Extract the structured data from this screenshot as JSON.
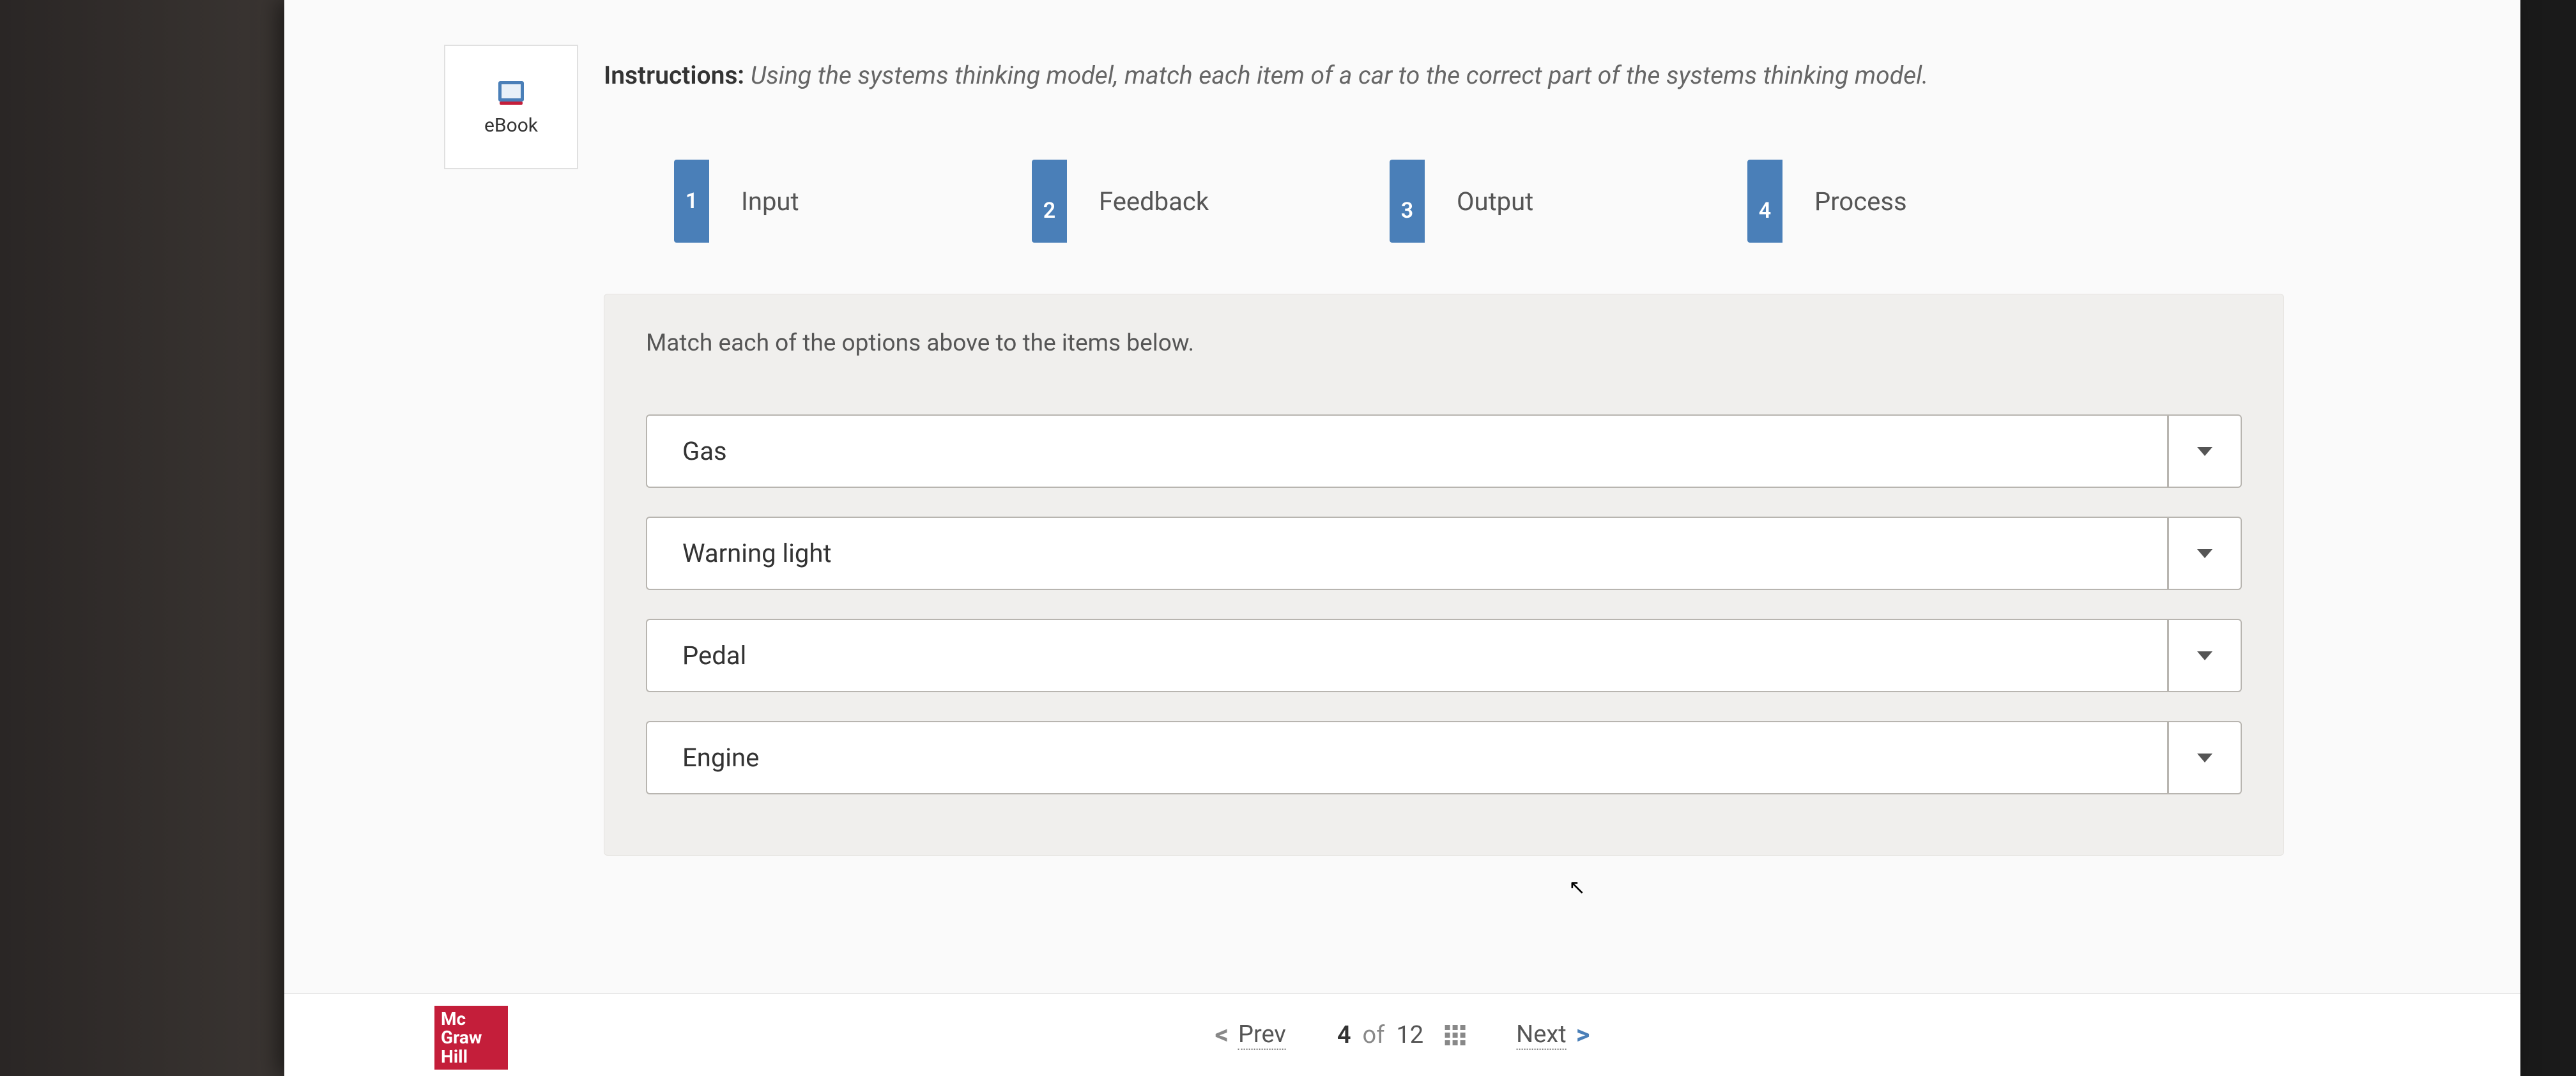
{
  "sidebar": {
    "ebook_label": "eBook"
  },
  "instructions": {
    "label": "Instructions:",
    "text": "Using the systems thinking model, match each item of a car to the correct part of the systems thinking model."
  },
  "options": [
    {
      "num": "1",
      "label": "Input"
    },
    {
      "num": "2",
      "label": "Feedback"
    },
    {
      "num": "3",
      "label": "Output"
    },
    {
      "num": "4",
      "label": "Process"
    }
  ],
  "match": {
    "instruction": "Match each of the options above to the items below.",
    "items": [
      {
        "label": "Gas"
      },
      {
        "label": "Warning light"
      },
      {
        "label": "Pedal"
      },
      {
        "label": "Engine"
      }
    ]
  },
  "footer": {
    "logo_line1": "Mc",
    "logo_line2": "Graw",
    "logo_line3": "Hill",
    "prev_label": "Prev",
    "next_label": "Next",
    "page_current": "4",
    "page_of": "of",
    "page_total": "12"
  }
}
